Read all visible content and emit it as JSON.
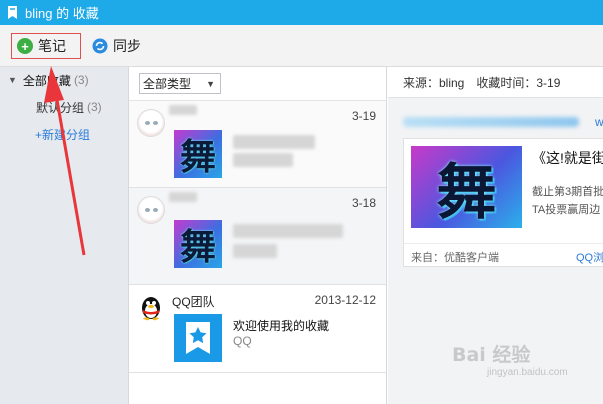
{
  "window": {
    "title": "bling 的 收藏"
  },
  "toolbar": {
    "note_label": "笔记",
    "sync_label": "同步"
  },
  "sidebar": {
    "all": {
      "label": "全部收藏",
      "count": "(3)"
    },
    "default_group": {
      "label": "默认分组",
      "count": "(3)"
    },
    "new_group_label": "+新建分组"
  },
  "list": {
    "filter_value": "全部类型",
    "items": [
      {
        "date": "3-19"
      },
      {
        "date": "3-18"
      },
      {
        "name": "QQ团队",
        "date": "2013-12-12",
        "title": "欢迎使用我的收藏",
        "subtitle": "QQ"
      }
    ]
  },
  "detail": {
    "source_label": "来源：bling",
    "time_label": "收藏时间：3-19",
    "card": {
      "title": "《这!就是街",
      "line1": "截止第3期首批",
      "line2": "TA投票赢周边",
      "from": "来自：优酷客户端",
      "app": "QQ浏"
    },
    "partial_link": "w"
  },
  "watermark": {
    "text": "Bai 经验",
    "sub": "jingyan.baidu.com"
  },
  "colors": {
    "titlebar": "#1ea9e8",
    "link": "#2b7cd8",
    "annotation": "#e8363a"
  }
}
